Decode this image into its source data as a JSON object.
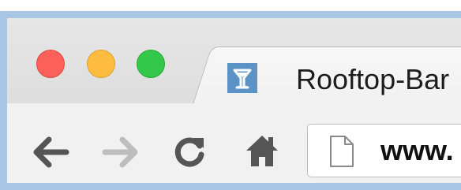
{
  "window": {
    "controls": [
      "close",
      "minimize",
      "zoom"
    ]
  },
  "tab": {
    "title": "Rooftop-Bar",
    "favicon": "cocktail-glass-icon"
  },
  "toolbar": {
    "back": "arrow-left-icon",
    "forward": "arrow-right-icon",
    "reload": "reload-icon",
    "home": "home-icon"
  },
  "omnibox": {
    "page_icon": "page-icon",
    "url": "www."
  },
  "colors": {
    "close": "#fc605b",
    "minimize": "#fdbc40",
    "zoom": "#34c84a",
    "favicon_bg": "#5b93c7",
    "frame": "#a9c6e6"
  }
}
